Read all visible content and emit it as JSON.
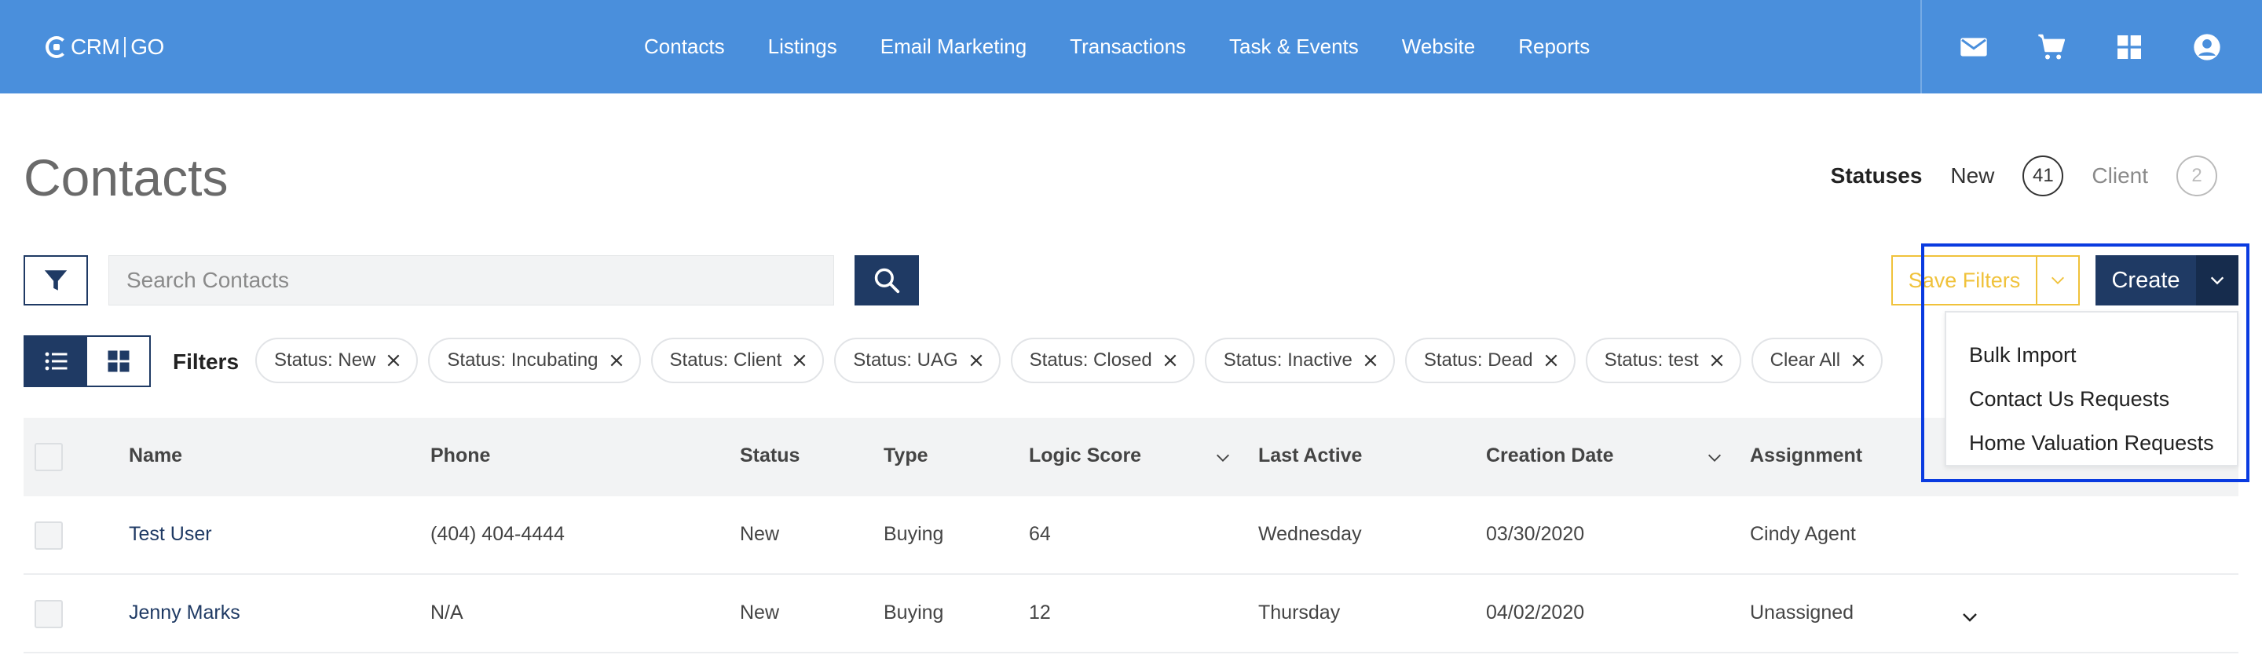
{
  "brand": {
    "name": "CRM",
    "suffix": "GO"
  },
  "nav": [
    "Contacts",
    "Listings",
    "Email Marketing",
    "Transactions",
    "Task & Events",
    "Website",
    "Reports"
  ],
  "top_icons": [
    "mail-icon",
    "cart-icon",
    "apps-grid-icon",
    "user-account-icon"
  ],
  "page": {
    "title": "Contacts"
  },
  "statuses": {
    "label": "Statuses",
    "items": [
      {
        "name": "New",
        "count": "41"
      },
      {
        "name": "Client",
        "count": "2"
      }
    ]
  },
  "search": {
    "placeholder": "Search Contacts",
    "value": ""
  },
  "actions": {
    "save_filters": "Save Filters",
    "create": "Create"
  },
  "create_menu": [
    "Bulk Import",
    "Contact Us Requests",
    "Home Valuation Requests"
  ],
  "filters": {
    "label": "Filters",
    "chips": [
      "Status: New",
      "Status: Incubating",
      "Status: Client",
      "Status: UAG",
      "Status: Closed",
      "Status: Inactive",
      "Status: Dead",
      "Status: test",
      "Clear All"
    ]
  },
  "table": {
    "columns": [
      "Name",
      "Phone",
      "Status",
      "Type",
      "Logic Score",
      "Last Active",
      "Creation Date",
      "Assignment"
    ],
    "rows": [
      {
        "name": "Test User",
        "phone": "(404) 404-4444",
        "status": "New",
        "type": "Buying",
        "score": "64",
        "last_active": "Wednesday",
        "created": "03/30/2020",
        "assignment": "Cindy Agent"
      },
      {
        "name": "Jenny Marks",
        "phone": "N/A",
        "status": "New",
        "type": "Buying",
        "score": "12",
        "last_active": "Thursday",
        "created": "04/02/2020",
        "assignment": "Unassigned"
      }
    ]
  },
  "colors": {
    "topbar": "#4a8fdc",
    "navy": "#1f3a64",
    "save_filters": "#f0c23b",
    "highlight": "#0a3be0"
  }
}
